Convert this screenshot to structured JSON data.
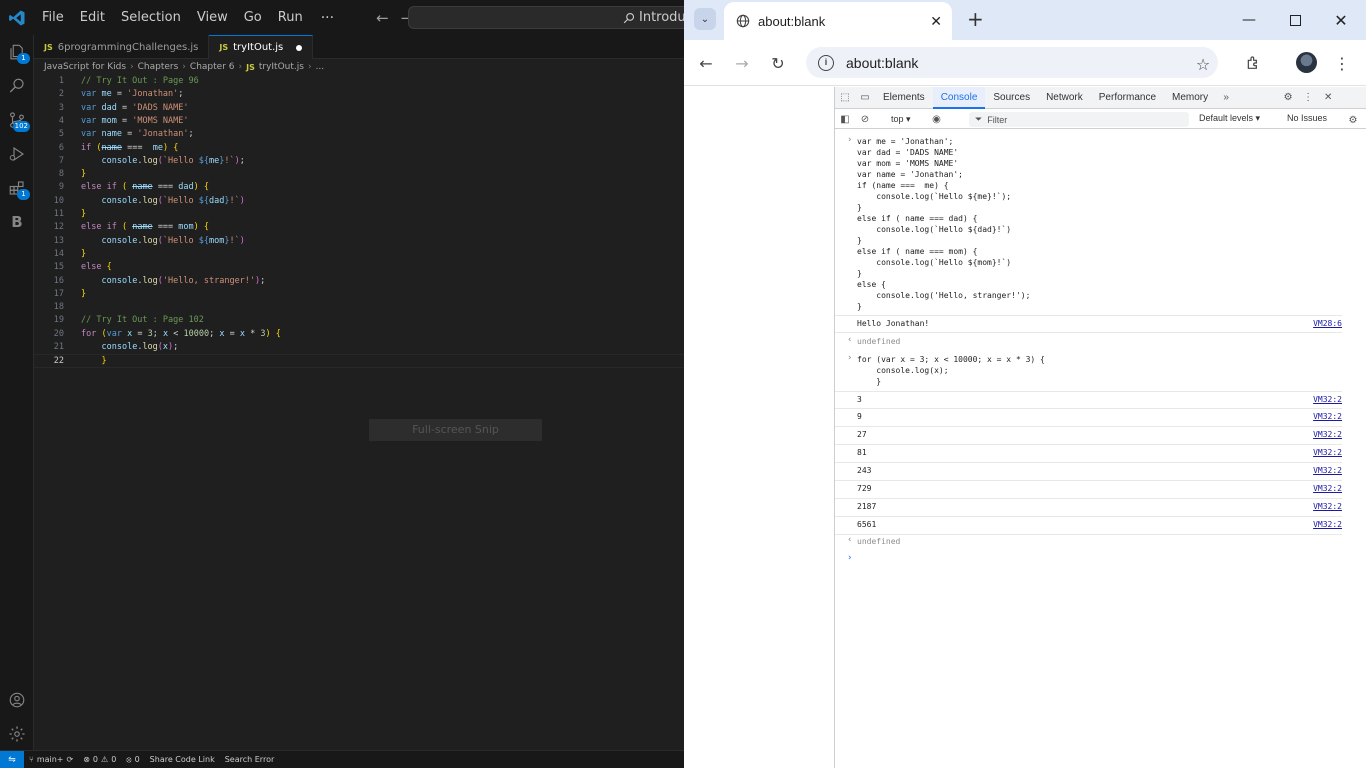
{
  "vscode": {
    "menu": [
      "File",
      "Edit",
      "Selection",
      "View",
      "Go",
      "Run"
    ],
    "menu_more": "···",
    "command_center": "Introdu",
    "tabs": [
      {
        "label": "6programmingChallenges.js",
        "icon": "JS"
      },
      {
        "label": "tryItOut.js",
        "icon": "JS"
      }
    ],
    "breadcrumb": [
      "JavaScript for Kids",
      "Chapters",
      "Chapter 6",
      "tryItOut.js",
      "..."
    ],
    "activity_badges": {
      "explorer": "1",
      "source_control": "102",
      "extensions": "1"
    },
    "code_lines": [
      "// Try It Out : Page 96",
      "var me = 'Jonathan';",
      "var dad = 'DADS NAME'",
      "var mom = 'MOMS NAME'",
      "var name = 'Jonathan';",
      "if (name ===  me) {",
      "    console.log(`Hello ${me}!`);",
      "}",
      "else if ( name === dad) {",
      "    console.log(`Hello ${dad}!`)",
      "}",
      "else if ( name === mom) {",
      "    console.log(`Hello ${mom}!`)",
      "}",
      "else {",
      "    console.log('Hello, stranger!');",
      "}",
      "",
      "// Try It Out : Page 102",
      "for (var x = 3; x < 10000; x = x * 3) {",
      "    console.log(x);",
      "    }"
    ],
    "snip_overlay": "Full-screen Snip",
    "status": {
      "branch": "main+",
      "errors": "0",
      "warnings": "0",
      "ports": "0",
      "share": "Share Code Link",
      "search_error": "Search Error"
    }
  },
  "chrome": {
    "tab_title": "about:blank",
    "url": "about:blank",
    "devtools": {
      "tabs": [
        "Elements",
        "Console",
        "Sources",
        "Network",
        "Performance",
        "Memory"
      ],
      "active_tab": "Console",
      "context": "top",
      "filter_placeholder": "Filter",
      "levels": "Default levels",
      "issues": "No Issues",
      "input1": [
        "var me = 'Jonathan';",
        "var dad = 'DADS NAME'",
        "var mom = 'MOMS NAME'",
        "var name = 'Jonathan';",
        "if (name ===  me) {",
        "    console.log(`Hello ${me}!`);",
        "}",
        "else if ( name === dad) {",
        "    console.log(`Hello ${dad}!`)",
        "}",
        "else if ( name === mom) {",
        "    console.log(`Hello ${mom}!`)",
        "}",
        "else {",
        "    console.log('Hello, stranger!');",
        "}"
      ],
      "output1": {
        "value": "Hello Jonathan!",
        "source": "VM28:6"
      },
      "undefined_text": "undefined",
      "input2": [
        "for (var x = 3; x < 10000; x = x * 3) {",
        "    console.log(x);",
        "    }"
      ],
      "output2": [
        {
          "value": "3",
          "source": "VM32:2"
        },
        {
          "value": "9",
          "source": "VM32:2"
        },
        {
          "value": "27",
          "source": "VM32:2"
        },
        {
          "value": "81",
          "source": "VM32:2"
        },
        {
          "value": "243",
          "source": "VM32:2"
        },
        {
          "value": "729",
          "source": "VM32:2"
        },
        {
          "value": "2187",
          "source": "VM32:2"
        },
        {
          "value": "6561",
          "source": "VM32:2"
        }
      ]
    }
  }
}
